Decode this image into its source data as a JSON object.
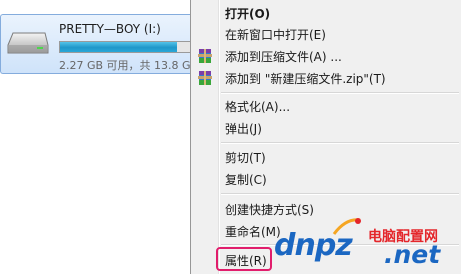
{
  "drive": {
    "name": "PRETTY—BOY (I:)",
    "info": "2.27 GB 可用，共 13.8 G",
    "used_fraction": 0.84,
    "icon": "removable-drive-icon"
  },
  "menu": {
    "items": [
      {
        "label": "打开(O)",
        "bold": true,
        "icon": null
      },
      {
        "label": "在新窗口中打开(E)",
        "icon": null
      },
      {
        "label": "添加到压缩文件(A) ...",
        "icon": "winrar-archive-icon"
      },
      {
        "label": "添加到 \"新建压缩文件.zip\"(T)",
        "icon": "winrar-archive-icon"
      },
      {
        "label": "格式化(A)...",
        "icon": null
      },
      {
        "label": "弹出(J)",
        "icon": null
      },
      {
        "label": "剪切(T)",
        "icon": null
      },
      {
        "label": "复制(C)",
        "icon": null
      },
      {
        "label": "创建快捷方式(S)",
        "icon": null
      },
      {
        "label": "重命名(M)",
        "icon": null
      },
      {
        "label": "属性(R)",
        "icon": null,
        "highlighted": true
      }
    ]
  },
  "watermark": {
    "logo_text": "dnpz",
    "cn_text": "电脑配置网",
    "domain_text": ".net"
  },
  "colors": {
    "highlight_border": "#e11d6c",
    "progress_fill": "#1f97c9",
    "menu_background": "#f0f0f0"
  }
}
